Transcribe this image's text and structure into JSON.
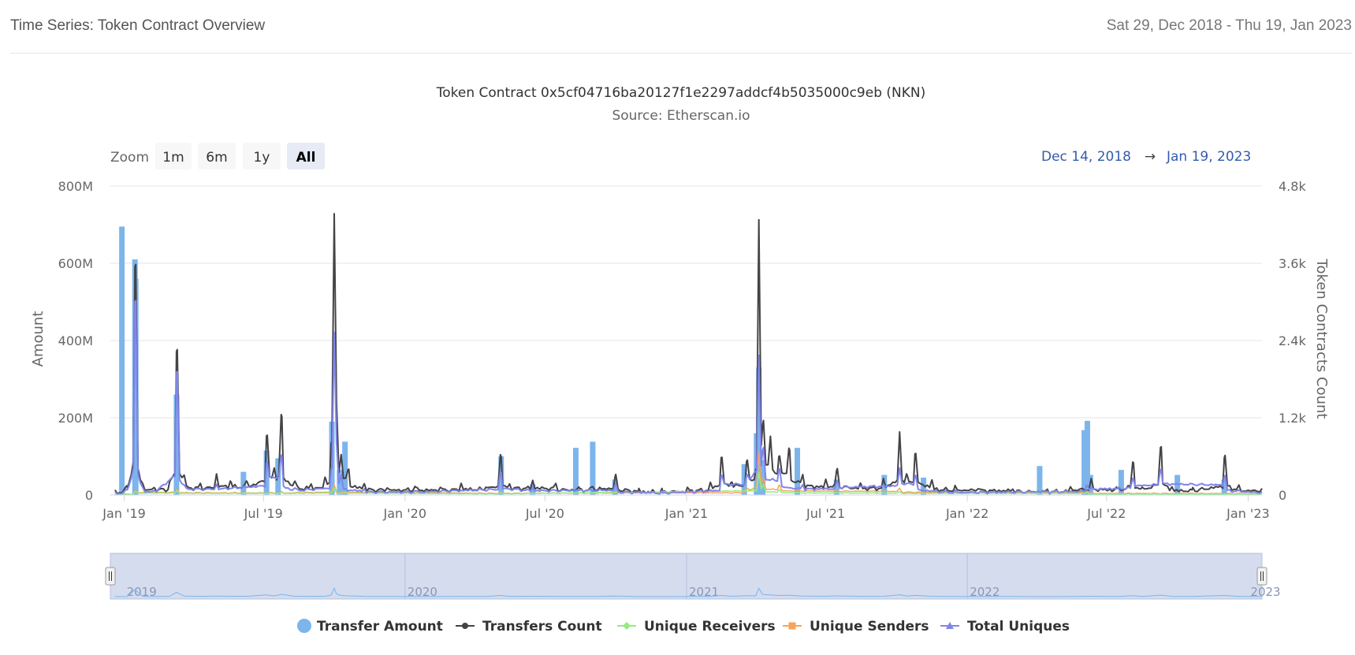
{
  "header": {
    "title": "Time Series: Token Contract Overview",
    "date_range": "Sat 29, Dec 2018 - Thu 19, Jan 2023"
  },
  "range_selector": {
    "zoom_label": "Zoom",
    "buttons": [
      {
        "label": "1m",
        "active": false
      },
      {
        "label": "6m",
        "active": false
      },
      {
        "label": "1y",
        "active": false
      },
      {
        "label": "All",
        "active": true
      }
    ],
    "from": "Dec 14, 2018",
    "arrow": "→",
    "to": "Jan 19, 2023"
  },
  "navigator": {
    "year_labels": [
      "2019",
      "2020",
      "2021",
      "2022",
      "2023"
    ]
  },
  "chart_data": {
    "type": "line",
    "title": "Token Contract 0x5cf04716ba20127f1e2297addcf4b5035000c9eb (NKN)",
    "subtitle": "Source: Etherscan.io",
    "x_start": "2018-12-14",
    "x_end": "2023-01-19",
    "x_ticks": [
      {
        "date": "2019-01-01",
        "label": "Jan '19"
      },
      {
        "date": "2019-07-01",
        "label": "Jul '19"
      },
      {
        "date": "2020-01-01",
        "label": "Jan '20"
      },
      {
        "date": "2020-07-01",
        "label": "Jul '20"
      },
      {
        "date": "2021-01-01",
        "label": "Jan '21"
      },
      {
        "date": "2021-07-01",
        "label": "Jul '21"
      },
      {
        "date": "2022-01-01",
        "label": "Jan '22"
      },
      {
        "date": "2022-07-01",
        "label": "Jul '22"
      },
      {
        "date": "2023-01-01",
        "label": "Jan '23"
      }
    ],
    "y_left": {
      "label": "Amount",
      "range": [
        0,
        800000000
      ],
      "ticks": [
        0,
        200000000,
        400000000,
        600000000,
        800000000
      ],
      "tick_labels": [
        "0",
        "200M",
        "400M",
        "600M",
        "800M"
      ]
    },
    "y_right": {
      "label": "Token Contracts Count",
      "range": [
        0,
        4800
      ],
      "ticks": [
        0,
        1200,
        2400,
        3600,
        4800
      ],
      "tick_labels": [
        "0",
        "1.2k",
        "2.4k",
        "3.6k",
        "4.8k"
      ]
    },
    "grid": true,
    "legend_position": "bottom",
    "series": [
      {
        "name": "Transfer Amount",
        "kind": "column",
        "axis": "left",
        "color": "#7cb5ec",
        "points": [
          [
            "2018-12-29",
            695000000
          ],
          [
            "2019-01-15",
            610000000
          ],
          [
            "2019-01-16",
            560000000
          ],
          [
            "2019-03-10",
            260000000
          ],
          [
            "2019-06-05",
            60000000
          ],
          [
            "2019-07-05",
            115000000
          ],
          [
            "2019-07-20",
            95000000
          ],
          [
            "2019-09-28",
            190000000
          ],
          [
            "2019-10-08",
            65000000
          ],
          [
            "2019-10-15",
            138000000
          ],
          [
            "2020-05-05",
            100000000
          ],
          [
            "2020-06-15",
            28000000
          ],
          [
            "2020-08-10",
            122000000
          ],
          [
            "2020-09-01",
            138000000
          ],
          [
            "2020-09-30",
            40000000
          ],
          [
            "2021-03-17",
            80000000
          ],
          [
            "2021-04-02",
            160000000
          ],
          [
            "2021-04-05",
            330000000
          ],
          [
            "2021-04-10",
            90000000
          ],
          [
            "2021-05-25",
            122000000
          ],
          [
            "2021-07-15",
            40000000
          ],
          [
            "2021-09-15",
            52000000
          ],
          [
            "2021-11-05",
            45000000
          ],
          [
            "2022-04-05",
            75000000
          ],
          [
            "2022-06-02",
            168000000
          ],
          [
            "2022-06-06",
            192000000
          ],
          [
            "2022-06-10",
            52000000
          ],
          [
            "2022-07-20",
            65000000
          ],
          [
            "2022-10-01",
            52000000
          ],
          [
            "2022-12-01",
            40000000
          ]
        ]
      },
      {
        "name": "Transfers Count",
        "kind": "line",
        "axis": "right",
        "color": "#434348",
        "points": [
          [
            "2018-12-20",
            30
          ],
          [
            "2019-01-05",
            120
          ],
          [
            "2019-01-15",
            3550
          ],
          [
            "2019-01-25",
            150
          ],
          [
            "2019-02-10",
            100
          ],
          [
            "2019-03-01",
            200
          ],
          [
            "2019-03-10",
            2230
          ],
          [
            "2019-03-20",
            300
          ],
          [
            "2019-04-10",
            150
          ],
          [
            "2019-05-01",
            300
          ],
          [
            "2019-05-20",
            200
          ],
          [
            "2019-06-10",
            200
          ],
          [
            "2019-07-05",
            920
          ],
          [
            "2019-07-15",
            400
          ],
          [
            "2019-07-25",
            1220
          ],
          [
            "2019-08-10",
            200
          ],
          [
            "2019-09-01",
            150
          ],
          [
            "2019-09-20",
            250
          ],
          [
            "2019-09-27",
            800
          ],
          [
            "2019-10-01",
            4330
          ],
          [
            "2019-10-04",
            1400
          ],
          [
            "2019-10-10",
            600
          ],
          [
            "2019-10-20",
            400
          ],
          [
            "2019-11-10",
            150
          ],
          [
            "2019-12-10",
            100
          ],
          [
            "2020-01-15",
            120
          ],
          [
            "2020-02-15",
            100
          ],
          [
            "2020-03-15",
            150
          ],
          [
            "2020-04-15",
            120
          ],
          [
            "2020-05-05",
            600
          ],
          [
            "2020-05-15",
            150
          ],
          [
            "2020-06-15",
            200
          ],
          [
            "2020-07-15",
            150
          ],
          [
            "2020-08-15",
            100
          ],
          [
            "2020-09-01",
            120
          ],
          [
            "2020-09-30",
            280
          ],
          [
            "2020-10-30",
            60
          ],
          [
            "2020-12-01",
            50
          ],
          [
            "2021-01-01",
            80
          ],
          [
            "2021-02-01",
            150
          ],
          [
            "2021-02-15",
            580
          ],
          [
            "2021-03-01",
            200
          ],
          [
            "2021-03-20",
            520
          ],
          [
            "2021-04-01",
            400
          ],
          [
            "2021-04-05",
            4250
          ],
          [
            "2021-04-10",
            1100
          ],
          [
            "2021-04-20",
            900
          ],
          [
            "2021-05-01",
            600
          ],
          [
            "2021-05-15",
            700
          ],
          [
            "2021-06-01",
            300
          ],
          [
            "2021-07-01",
            200
          ],
          [
            "2021-07-15",
            380
          ],
          [
            "2021-08-15",
            150
          ],
          [
            "2021-09-15",
            200
          ],
          [
            "2021-10-05",
            950
          ],
          [
            "2021-10-15",
            300
          ],
          [
            "2021-10-25",
            640
          ],
          [
            "2021-11-15",
            200
          ],
          [
            "2021-12-15",
            100
          ],
          [
            "2022-01-15",
            100
          ],
          [
            "2022-03-01",
            80
          ],
          [
            "2022-04-15",
            50
          ],
          [
            "2022-05-15",
            100
          ],
          [
            "2022-06-10",
            200
          ],
          [
            "2022-07-15",
            100
          ],
          [
            "2022-08-05",
            500
          ],
          [
            "2022-08-15",
            100
          ],
          [
            "2022-09-10",
            750
          ],
          [
            "2022-09-25",
            100
          ],
          [
            "2022-10-20",
            80
          ],
          [
            "2022-12-01",
            580
          ],
          [
            "2022-12-20",
            100
          ],
          [
            "2023-01-19",
            80
          ]
        ]
      },
      {
        "name": "Unique Receivers",
        "kind": "line",
        "axis": "right",
        "color": "#90ed7d",
        "points": [
          [
            "2018-12-20",
            10
          ],
          [
            "2019-01-15",
            50
          ],
          [
            "2019-03-10",
            60
          ],
          [
            "2019-07-25",
            40
          ],
          [
            "2019-10-01",
            100
          ],
          [
            "2020-05-05",
            30
          ],
          [
            "2021-04-05",
            350
          ],
          [
            "2021-04-10",
            150
          ],
          [
            "2021-05-01",
            80
          ],
          [
            "2021-10-05",
            50
          ],
          [
            "2022-06-06",
            40
          ],
          [
            "2023-01-19",
            20
          ]
        ]
      },
      {
        "name": "Unique Senders",
        "kind": "line",
        "axis": "right",
        "color": "#f7a35c",
        "points": [
          [
            "2018-12-20",
            10
          ],
          [
            "2019-01-15",
            60
          ],
          [
            "2019-03-10",
            80
          ],
          [
            "2019-07-25",
            50
          ],
          [
            "2019-10-01",
            150
          ],
          [
            "2020-05-05",
            40
          ],
          [
            "2021-03-20",
            100
          ],
          [
            "2021-04-05",
            650
          ],
          [
            "2021-04-10",
            250
          ],
          [
            "2021-05-01",
            150
          ],
          [
            "2021-10-05",
            100
          ],
          [
            "2022-06-06",
            60
          ],
          [
            "2023-01-19",
            30
          ]
        ]
      },
      {
        "name": "Total Uniques",
        "kind": "line",
        "axis": "right",
        "color": "#8085e9",
        "points": [
          [
            "2018-12-20",
            20
          ],
          [
            "2019-01-05",
            80
          ],
          [
            "2019-01-15",
            3000
          ],
          [
            "2019-01-25",
            100
          ],
          [
            "2019-02-10",
            60
          ],
          [
            "2019-03-10",
            1900
          ],
          [
            "2019-03-20",
            150
          ],
          [
            "2019-05-01",
            150
          ],
          [
            "2019-07-05",
            500
          ],
          [
            "2019-07-25",
            600
          ],
          [
            "2019-08-10",
            100
          ],
          [
            "2019-09-27",
            400
          ],
          [
            "2019-10-01",
            2500
          ],
          [
            "2019-10-04",
            800
          ],
          [
            "2019-10-10",
            300
          ],
          [
            "2019-11-10",
            80
          ],
          [
            "2020-01-15",
            60
          ],
          [
            "2020-05-05",
            350
          ],
          [
            "2020-06-15",
            100
          ],
          [
            "2020-09-30",
            150
          ],
          [
            "2020-12-01",
            30
          ],
          [
            "2021-02-15",
            300
          ],
          [
            "2021-03-20",
            300
          ],
          [
            "2021-04-05",
            2150
          ],
          [
            "2021-04-10",
            700
          ],
          [
            "2021-05-01",
            400
          ],
          [
            "2021-06-01",
            150
          ],
          [
            "2021-07-15",
            200
          ],
          [
            "2021-10-05",
            400
          ],
          [
            "2021-10-25",
            300
          ],
          [
            "2021-12-15",
            50
          ],
          [
            "2022-06-06",
            150
          ],
          [
            "2022-08-05",
            250
          ],
          [
            "2022-09-10",
            400
          ],
          [
            "2022-12-01",
            280
          ],
          [
            "2023-01-19",
            40
          ]
        ]
      }
    ]
  }
}
